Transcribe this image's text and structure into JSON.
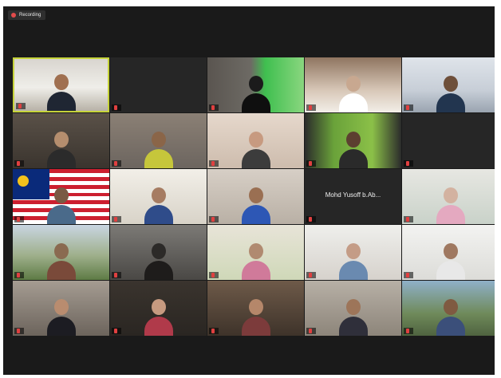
{
  "recording": {
    "label": "Recording"
  },
  "colors": {
    "active_speaker": "#c6d33a",
    "tile_bg": "#262626",
    "window_bg": "#1a1a1a",
    "muted": "#e04040"
  },
  "participants": [
    {
      "name": "",
      "video": "man-suit-office",
      "speaking": true
    },
    {
      "name": "",
      "center_text": "",
      "video": "none"
    },
    {
      "name": "",
      "video": "green-room"
    },
    {
      "name": "",
      "video": "hijab-bed"
    },
    {
      "name": "",
      "video": "man-mask-office"
    },
    {
      "name": "",
      "video": "dim-room"
    },
    {
      "name": "",
      "video": "man-yellow-room"
    },
    {
      "name": "",
      "video": "woman-mask"
    },
    {
      "name": "",
      "video": "green-wall"
    },
    {
      "name": "",
      "center_text": "",
      "video": "none"
    },
    {
      "name": "",
      "video": "malaysia-flag"
    },
    {
      "name": "",
      "video": "man-blue-shirt"
    },
    {
      "name": "",
      "video": "man-jersey"
    },
    {
      "name": "",
      "center_text": "Mohd Yusoff b.Ab...",
      "video": "none"
    },
    {
      "name": "",
      "video": "woman-pink-hijab"
    },
    {
      "name": "",
      "video": "house-outdoor"
    },
    {
      "name": "",
      "video": "dark-silhouette"
    },
    {
      "name": "",
      "video": "banner-person"
    },
    {
      "name": "",
      "video": "older-woman"
    },
    {
      "name": "",
      "video": "man-white-cap"
    },
    {
      "name": "",
      "video": "woman-dark-hijab"
    },
    {
      "name": "",
      "video": "woman-mask-dark"
    },
    {
      "name": "",
      "video": "woman-close"
    },
    {
      "name": "",
      "video": "man-close"
    },
    {
      "name": "",
      "video": "man-outdoor"
    }
  ]
}
